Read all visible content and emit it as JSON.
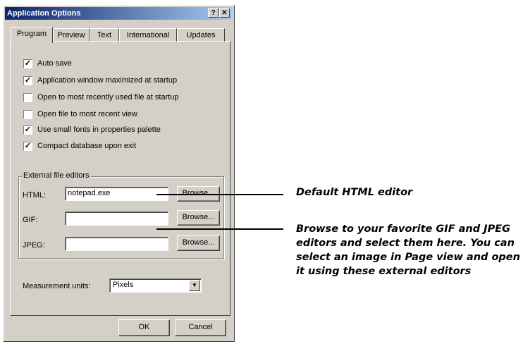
{
  "dialog": {
    "title": "Application Options",
    "help_glyph": "?",
    "close_glyph": "✕",
    "tabs": [
      {
        "label": "Program"
      },
      {
        "label": "Preview"
      },
      {
        "label": "Text"
      },
      {
        "label": "International"
      },
      {
        "label": "Updates"
      }
    ],
    "checkboxes": [
      {
        "label": "Auto save",
        "checked": true
      },
      {
        "label": "Application window maximized at startup",
        "checked": true
      },
      {
        "label": "Open to most recently used file at startup",
        "checked": false
      },
      {
        "label": "Open file to most recent view",
        "checked": false
      },
      {
        "label": "Use small fonts in properties palette",
        "checked": true
      },
      {
        "label": "Compact database upon exit",
        "checked": true
      }
    ],
    "editors_group": {
      "title": "External file editors",
      "rows": [
        {
          "label": "HTML:",
          "value": "notepad.exe",
          "button": "Browse..."
        },
        {
          "label": "GIF:",
          "value": "",
          "button": "Browse..."
        },
        {
          "label": "JPEG:",
          "value": "",
          "button": "Browse..."
        }
      ]
    },
    "measurement": {
      "label": "Measurement units:",
      "value": "Pixels",
      "arrow": "▼"
    },
    "buttons": {
      "ok": "OK",
      "cancel": "Cancel"
    }
  },
  "callouts": {
    "html_editor": "Default HTML editor",
    "browse_editors": [
      "Browse to your favorite GIF and JPEG",
      "editors and select them here. You can",
      "select an image in Page view and open",
      "it using these external editors"
    ]
  }
}
